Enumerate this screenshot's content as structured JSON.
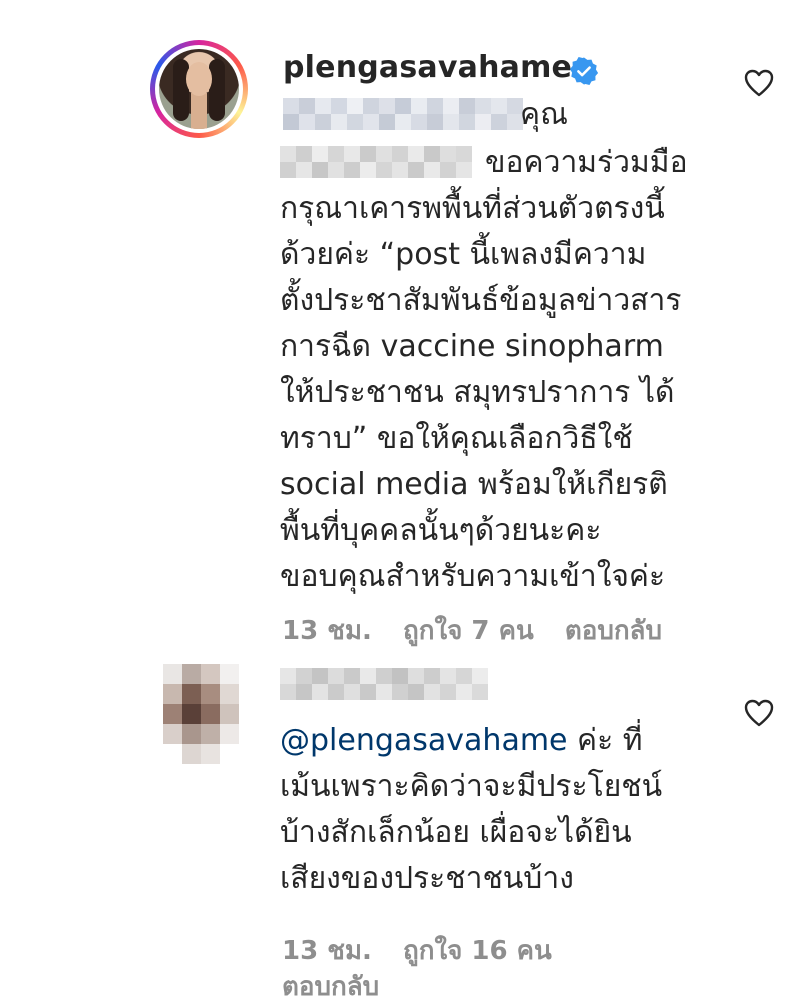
{
  "comments": [
    {
      "username": "plengasavahame",
      "verified": true,
      "line1_visible": "คุณ",
      "line2_visible": "ขอความร่วมมือ",
      "lines": [
        "กรุณาเคารพพื้นที่ส่วนตัวตรงนี้",
        "ด้วยค่ะ “post นี้เพลงมีความ",
        "ตั้งประชาสัมพันธ์ข้อมูลข่าวสาร",
        "การฉีด vaccine sinopharm",
        "ให้ประชาชน สมุทรปราการ ได้",
        "ทราบ” ขอให้คุณเลือกวิธีใช้",
        "social media พร้อมให้เกียรติ",
        "พื้นที่บุคคลนั้นๆด้วยนะคะ",
        "ขอบคุณสำหรับความเข้าใจค่ะ"
      ],
      "time": "13 ชม.",
      "likes": "ถูกใจ 7 คน",
      "reply": "ตอบกลับ"
    },
    {
      "mention": "@plengasavahame",
      "first_line_rest": " ค่ะ ที่",
      "lines": [
        "เม้นเพราะคิดว่าจะมีประโยชน์",
        "บ้างสักเล็กน้อย เผื่อจะได้ยิน",
        "เสียงของประชาชนบ้าง"
      ],
      "time": "13 ชม.",
      "likes": "ถูกใจ 16 คน",
      "reply": "ตอบกลับ"
    }
  ],
  "icons": {
    "verified": "verified-badge-icon",
    "like": "heart-icon",
    "verified_color": "#3897f0"
  }
}
